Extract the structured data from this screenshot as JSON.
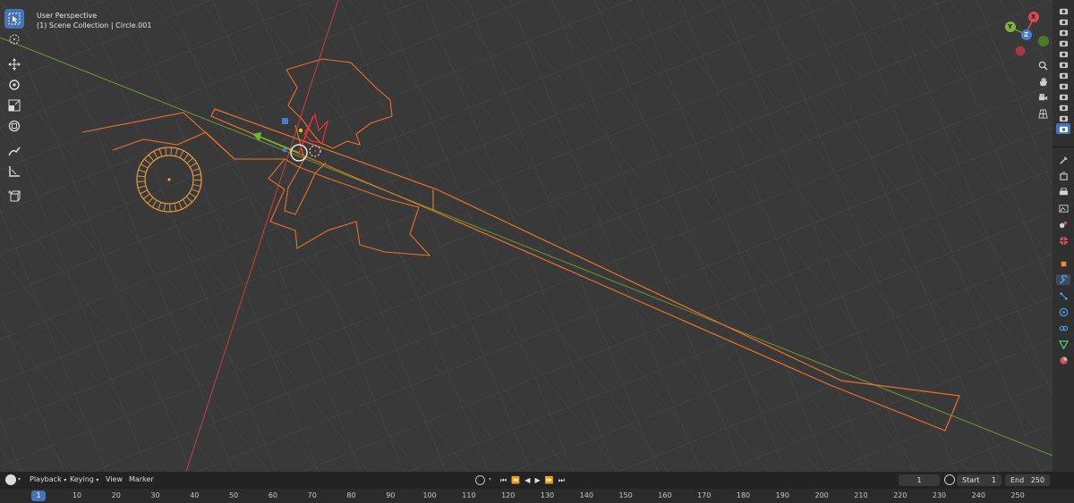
{
  "viewport": {
    "view_name": "User Perspective",
    "scene_info": "(1) Scene Collection | Circle.001"
  },
  "gizmo": {
    "x_label": "X",
    "y_label": "Y",
    "z_label": "Z"
  },
  "colors": {
    "accent": "#4772b3",
    "grid_bg": "#393939",
    "selection_orange": "#e8702a",
    "axis_red": "#c8403a",
    "axis_green": "#6a9a27"
  },
  "toolbar_icons": [
    "select-box-icon",
    "cursor-icon",
    "move-icon",
    "rotate-icon",
    "scale-icon",
    "transform-icon",
    "annotate-icon",
    "measure-icon",
    "add-cube-icon"
  ],
  "timeline": {
    "editor_icon": "clock-icon",
    "menus": [
      "Playback",
      "Keying",
      "View",
      "Marker"
    ],
    "current_frame": "1",
    "start_label": "Start",
    "start_value": "1",
    "end_label": "End",
    "end_value": "250",
    "ruler": [
      "1",
      "10",
      "20",
      "30",
      "40",
      "50",
      "60",
      "70",
      "80",
      "90",
      "100",
      "110",
      "120",
      "130",
      "140",
      "150",
      "160",
      "170",
      "180",
      "190",
      "200",
      "210",
      "220",
      "230",
      "240",
      "250"
    ]
  }
}
